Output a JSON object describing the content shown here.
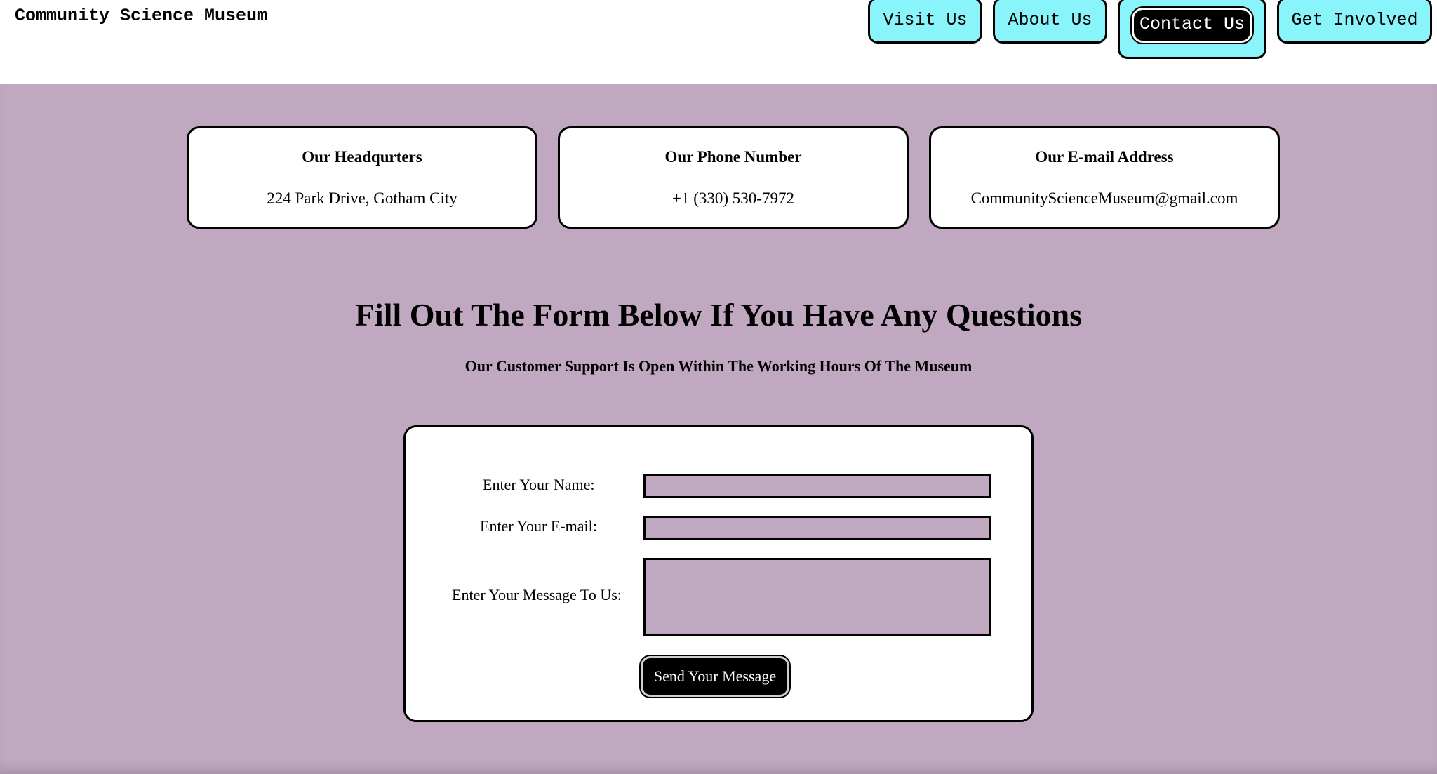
{
  "header": {
    "brand": "Community Science Museum",
    "nav": [
      {
        "label": "Visit Us",
        "active": false
      },
      {
        "label": "About Us",
        "active": false
      },
      {
        "label": "Contact Us",
        "active": true
      },
      {
        "label": "Get Involved",
        "active": false
      }
    ]
  },
  "contact_cards": [
    {
      "title": "Our Headqurters",
      "text": "224 Park Drive, Gotham City"
    },
    {
      "title": "Our Phone Number",
      "text": "+1 (330) 530-7972"
    },
    {
      "title": "Our E-mail Address",
      "text": "CommunityScienceMuseum@gmail.com"
    }
  ],
  "form_section": {
    "heading": "Fill Out The Form Below If You Have Any Questions",
    "subheading": "Our Customer Support Is Open Within The Working Hours Of The Museum",
    "name_label": "Enter Your Name:",
    "name_value": "",
    "email_label": "Enter Your E-mail:",
    "email_value": "",
    "message_label": "Enter Your Message To Us:",
    "message_value": "",
    "submit_label": "Send Your Message"
  },
  "colors": {
    "page_background": "#c0a8c0",
    "nav_button": "#8af4fb",
    "panel": "#ffffff",
    "accent_button": "#000000"
  }
}
